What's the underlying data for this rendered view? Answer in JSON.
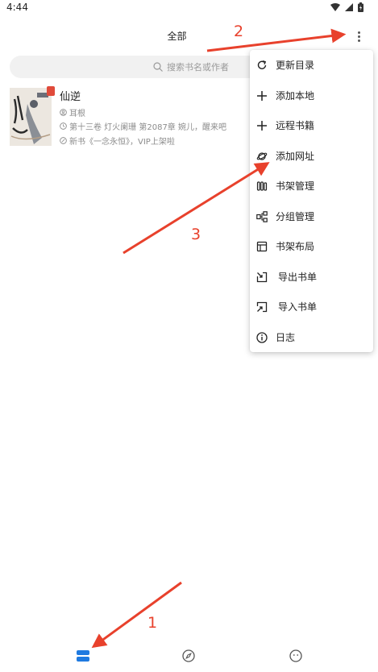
{
  "status_bar": {
    "time": "4:44"
  },
  "header": {
    "title": "全部"
  },
  "search": {
    "placeholder": "搜索书名或作者"
  },
  "book": {
    "title": "仙逆",
    "author": "耳根",
    "latest_chapter": "第十三卷 灯火阑珊 第2087章 婉儿，醒来吧",
    "note": "新书《一念永恒》，VIP上架啦"
  },
  "menu": {
    "items": [
      {
        "label": "更新目录",
        "icon": "refresh-icon"
      },
      {
        "label": "添加本地",
        "icon": "plus-icon"
      },
      {
        "label": "远程书籍",
        "icon": "plus-icon"
      },
      {
        "label": "添加网址",
        "icon": "planet-icon"
      },
      {
        "label": "书架管理",
        "icon": "books-icon"
      },
      {
        "label": "分组管理",
        "icon": "group-icon"
      },
      {
        "label": "书架布局",
        "icon": "layout-icon"
      },
      {
        "label": "导出书单",
        "icon": "export-icon"
      },
      {
        "label": "导入书单",
        "icon": "import-icon"
      },
      {
        "label": "日志",
        "icon": "info-icon"
      }
    ]
  },
  "bottom_nav": {
    "items": [
      {
        "icon": "bookshelf-icon",
        "active": true
      },
      {
        "icon": "compass-icon",
        "active": false
      },
      {
        "icon": "profile-icon",
        "active": false
      }
    ]
  },
  "annotations": {
    "label_1": "1",
    "label_2": "2",
    "label_3": "3"
  },
  "colors": {
    "accent": "#1f7ae0",
    "annotation": "#e8412c",
    "text": "#222222",
    "muted": "#8c8c8c"
  }
}
